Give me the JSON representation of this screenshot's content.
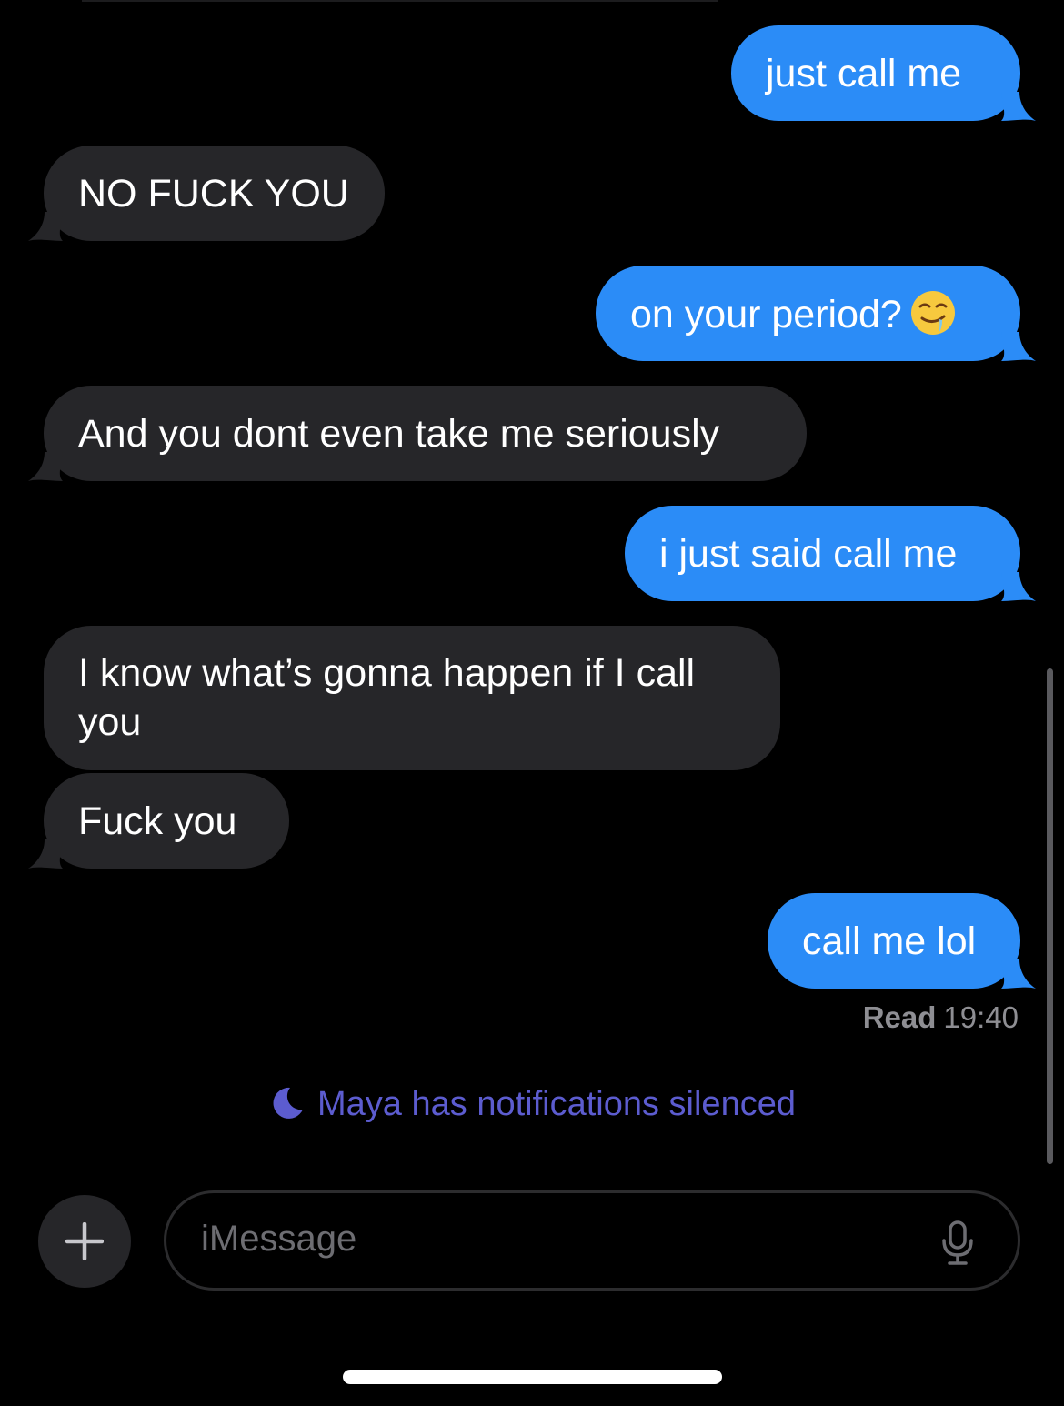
{
  "messages": [
    {
      "id": "b1",
      "direction": "outgoing",
      "text": "just call me"
    },
    {
      "id": "b2",
      "direction": "incoming",
      "text": "NO FUCK YOU"
    },
    {
      "id": "b3",
      "direction": "outgoing",
      "text": "on your period?",
      "emoji": "drooling-face-emoji"
    },
    {
      "id": "b4",
      "direction": "incoming",
      "text": "And you dont even take me seriously"
    },
    {
      "id": "b5",
      "direction": "outgoing",
      "text": "i just said call me"
    },
    {
      "id": "b6",
      "direction": "incoming",
      "text": "I know what’s gonna happen if I call you"
    },
    {
      "id": "b7",
      "direction": "incoming",
      "text": "Fuck you"
    },
    {
      "id": "b8",
      "direction": "outgoing",
      "text": "call me lol"
    }
  ],
  "receipt": {
    "label": "Read",
    "time": "19:40"
  },
  "silenced_notice": {
    "text": "Maya has notifications silenced",
    "icon": "moon-icon"
  },
  "composer": {
    "placeholder": "iMessage",
    "add_icon": "plus-icon",
    "mic_icon": "microphone-icon"
  },
  "colors": {
    "background": "#000000",
    "outgoing_bubble": "#2b8cf7",
    "incoming_bubble": "#262629",
    "silenced_text": "#5c5ccf",
    "receipt_text": "#8e8e93"
  }
}
